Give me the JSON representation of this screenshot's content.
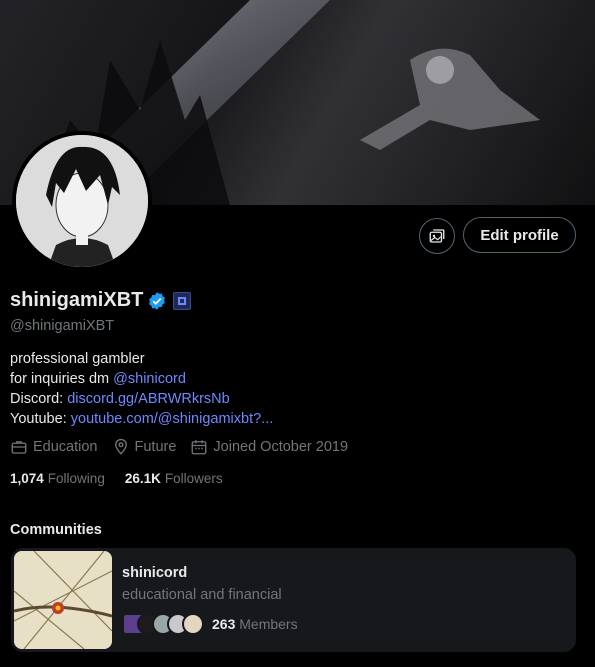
{
  "banner": {
    "description_icon": "banner-art"
  },
  "buttons": {
    "edit_profile": "Edit profile",
    "media_icon": "media-gallery-icon"
  },
  "profile": {
    "display_name": "shinigamiXBT",
    "handle": "@shinigamiXBT",
    "bio": {
      "line1": "professional gambler",
      "line2_prefix": "for inquiries dm ",
      "line2_link": "@shinicord",
      "line3_prefix": "Discord: ",
      "line3_link": "discord.gg/ABRWRkrsNb",
      "line4_prefix": "Youtube: ",
      "line4_link": "youtube.com/@shinigamixbt?..."
    },
    "meta": {
      "category": "Education",
      "location": "Future",
      "joined": "Joined October 2019"
    },
    "following_count": "1,074",
    "following_label": "Following",
    "followers_count": "26.1K",
    "followers_label": "Followers"
  },
  "communities": {
    "heading": "Communities",
    "items": [
      {
        "name": "shinicord",
        "description": "educational and financial",
        "members_count": "263",
        "members_label": "Members"
      }
    ]
  },
  "colors": {
    "background": "#000000",
    "text_primary": "#e7e9ea",
    "text_secondary": "#71767b",
    "link": "#6f88ff",
    "verified": "#1d9bf0",
    "card": "#16181c"
  }
}
